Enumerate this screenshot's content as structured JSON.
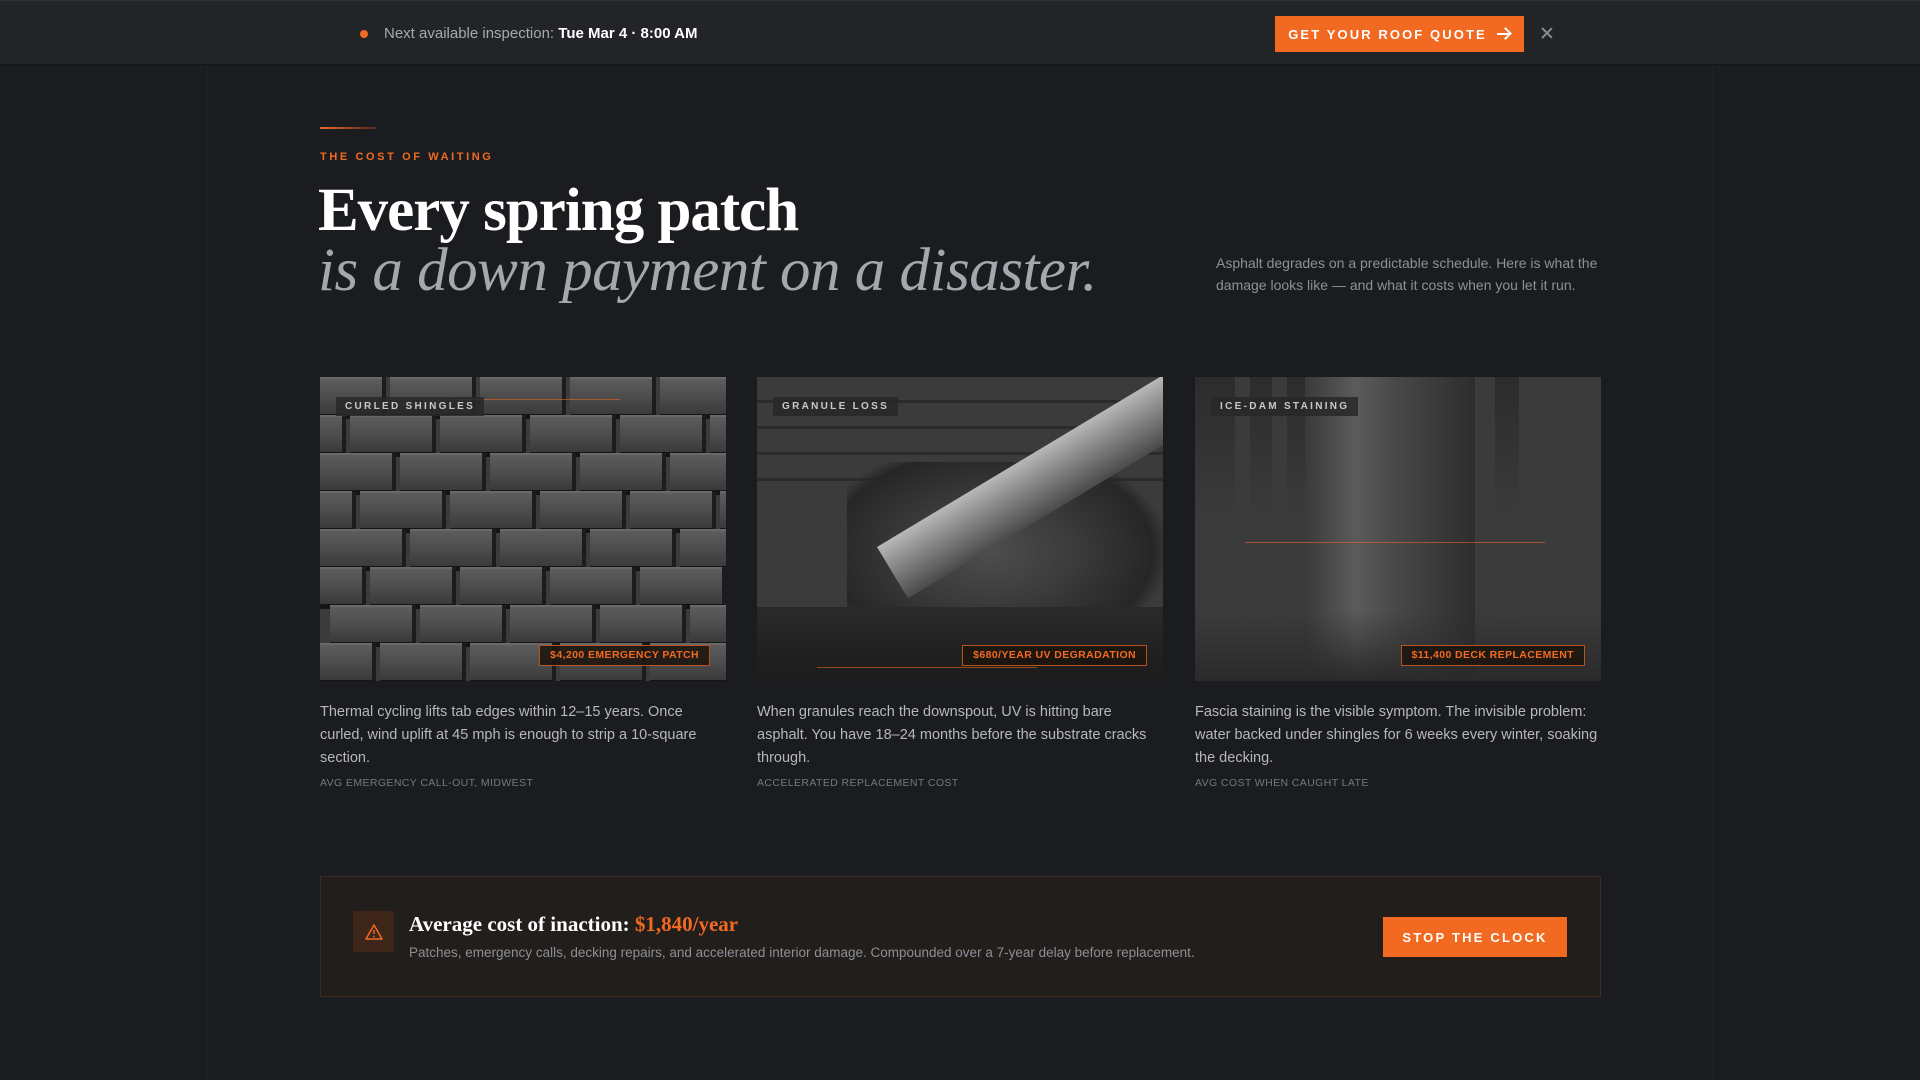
{
  "topbar": {
    "label": "Next available inspection:",
    "value": "Tue Mar 4 · 8:00 AM",
    "cta": "GET YOUR ROOF QUOTE"
  },
  "hero": {
    "eyebrow": "THE COST OF WAITING",
    "headline": "Every spring patch",
    "headline_italic": "is a down payment on a disaster.",
    "intro": "Asphalt degrades on a predictable schedule. Here is what the damage looks like — and what it costs when you let it run."
  },
  "cards": [
    {
      "tag": "CURLED SHINGLES",
      "price": "$4,200 EMERGENCY PATCH",
      "desc": "Thermal cycling lifts tab edges within 12–15 years. Once curled, wind uplift at 45 mph is enough to strip a 10-square section.",
      "caption": "AVG EMERGENCY CALL-OUT, MIDWEST"
    },
    {
      "tag": "GRANULE LOSS",
      "price": "$680/YEAR UV DEGRADATION",
      "desc": "When granules reach the downspout, UV is hitting bare asphalt. You have 18–24 months before the substrate cracks through.",
      "caption": "ACCELERATED REPLACEMENT COST"
    },
    {
      "tag": "ICE-DAM STAINING",
      "price": "$11,400 DECK REPLACEMENT",
      "desc": "Fascia staining is the visible symptom. The invisible problem: water backed under shingles for 6 weeks every winter, soaking the decking.",
      "caption": "AVG COST WHEN CAUGHT LATE"
    }
  ],
  "inaction": {
    "title": "Average cost of inaction:",
    "amount": "$1,840/year",
    "sub": "Patches, emergency calls, decking repairs, and accelerated interior damage. Compounded over a 7-year delay before replacement.",
    "cta": "STOP THE CLOCK"
  },
  "colors": {
    "accent": "#f26a21",
    "background": "#1b1c1f",
    "topbar": "#222428"
  }
}
